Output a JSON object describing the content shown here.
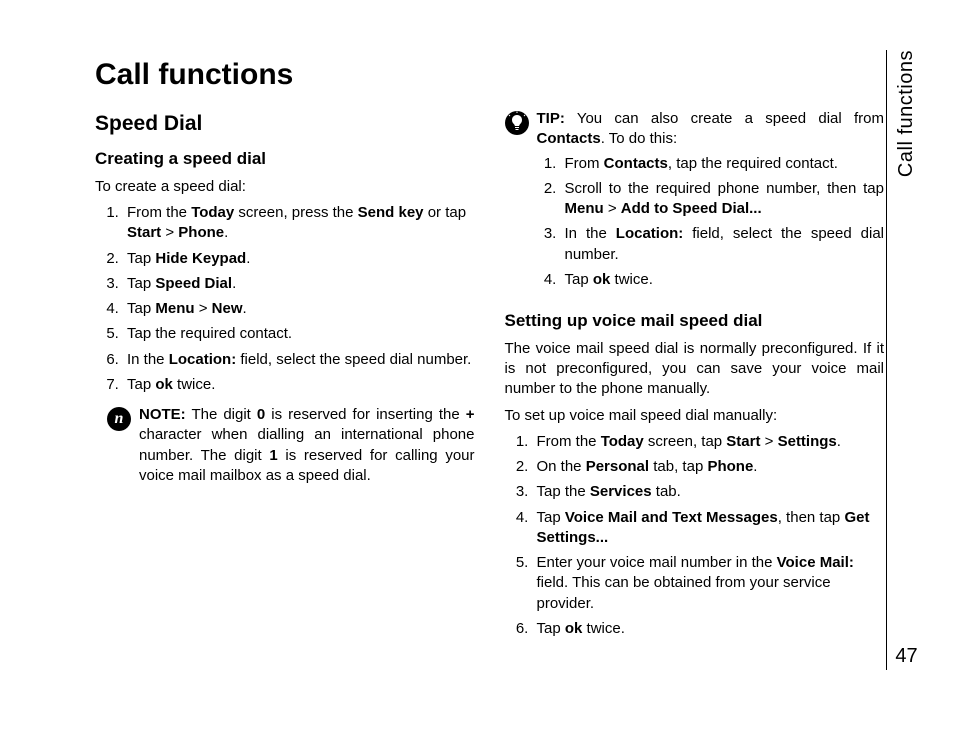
{
  "sideLabel": "Call functions",
  "pageNumber": "47",
  "title": "Call functions",
  "section1": {
    "heading": "Speed Dial",
    "sub1": {
      "heading": "Creating a speed dial",
      "intro": "To create a speed dial:",
      "steps": {
        "s1a": "From the ",
        "s1b": "Today",
        "s1c": " screen, press the ",
        "s1d": "Send key",
        "s1e": " or tap ",
        "s1f": "Start",
        "s1g": " > ",
        "s1h": "Phone",
        "s1i": ".",
        "s2a": "Tap ",
        "s2b": "Hide Keypad",
        "s2c": ".",
        "s3a": "Tap ",
        "s3b": "Speed Dial",
        "s3c": ".",
        "s4a": "Tap ",
        "s4b": "Menu",
        "s4c": " > ",
        "s4d": "New",
        "s4e": ".",
        "s5": "Tap the required contact.",
        "s6a": "In the ",
        "s6b": "Location:",
        "s6c": " field, select the speed dial number.",
        "s7a": "Tap ",
        "s7b": "ok",
        "s7c": " twice."
      },
      "note": {
        "label": "NOTE:",
        "t1": " The digit ",
        "t2": "0",
        "t3": " is reserved for inserting the ",
        "t4": "+",
        "t5": " character when dialling an international phone number. The digit ",
        "t6": "1",
        "t7": " is reserved for calling your voice mail mailbox as a speed dial."
      }
    }
  },
  "tip": {
    "label": "TIP:",
    "t1": " You can also create a speed dial from ",
    "t2": "Contacts",
    "t3": ". To do this:",
    "steps": {
      "s1a": "From ",
      "s1b": "Contacts",
      "s1c": ", tap the required contact.",
      "s2a": "Scroll to the required phone number, then tap ",
      "s2b": "Menu",
      "s2c": " > ",
      "s2d": "Add to Speed Dial...",
      "s3a": "In the ",
      "s3b": "Location:",
      "s3c": " field, select the speed dial number.",
      "s4a": "Tap ",
      "s4b": "ok",
      "s4c": " twice."
    }
  },
  "section2": {
    "heading": "Setting up voice mail speed dial",
    "p1": "The voice mail speed dial is normally preconfigured. If it is not preconfigured, you can save your voice mail number to the phone manually.",
    "intro": "To set up voice mail speed dial manually:",
    "steps": {
      "s1a": "From the ",
      "s1b": "Today",
      "s1c": " screen, tap ",
      "s1d": "Start",
      "s1e": " > ",
      "s1f": "Settings",
      "s1g": ".",
      "s2a": "On the ",
      "s2b": "Personal",
      "s2c": " tab, tap ",
      "s2d": "Phone",
      "s2e": ".",
      "s3a": "Tap the ",
      "s3b": "Services",
      "s3c": " tab.",
      "s4a": "Tap ",
      "s4b": "Voice Mail and Text Messages",
      "s4c": ", then tap ",
      "s4d": "Get Settings...",
      "s5a": "Enter your voice mail number in the ",
      "s5b": "Voice Mail:",
      "s5c": " field. This can be obtained from your service provider.",
      "s6a": "Tap ",
      "s6b": "ok",
      "s6c": " twice."
    }
  }
}
